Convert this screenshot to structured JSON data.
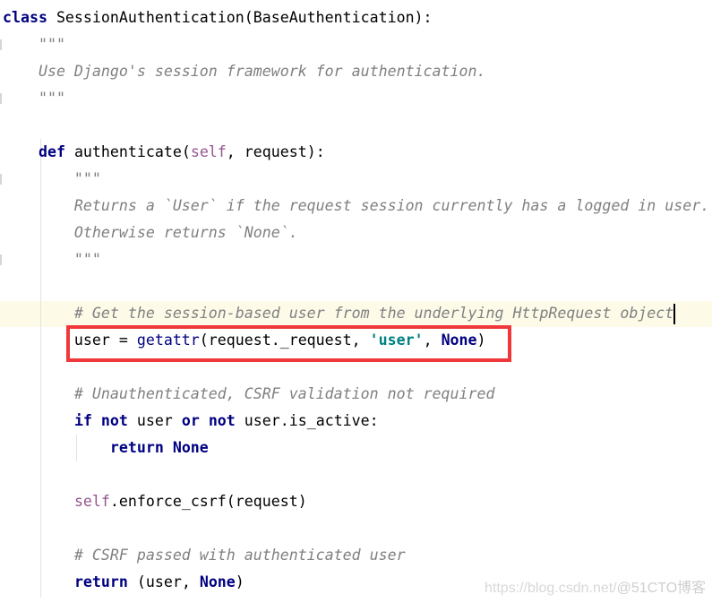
{
  "editor": {
    "lines": [
      [
        [
          "kw",
          "class"
        ],
        [
          "t",
          " SessionAuthentication(BaseAuthentication):"
        ]
      ],
      [
        [
          "doc",
          "    \"\"\""
        ]
      ],
      [
        [
          "doc",
          "    Use Django's session framework for authentication."
        ]
      ],
      [
        [
          "doc",
          "    \"\"\""
        ]
      ],
      [],
      [
        [
          "t",
          "    "
        ],
        [
          "kw",
          "def"
        ],
        [
          "t",
          " authenticate("
        ],
        [
          "self",
          "self"
        ],
        [
          "t",
          ", request):"
        ]
      ],
      [
        [
          "doc",
          "        \"\"\""
        ]
      ],
      [
        [
          "doc",
          "        Returns a `User` if the request session currently has a logged in user."
        ]
      ],
      [
        [
          "doc",
          "        Otherwise returns `None`."
        ]
      ],
      [
        [
          "doc",
          "        \"\"\""
        ]
      ],
      [],
      [
        [
          "cm",
          "        # Get the session-based user from the underlying HttpRequest object"
        ]
      ],
      [
        [
          "t",
          "        user = "
        ],
        [
          "bi",
          "getattr"
        ],
        [
          "t",
          "(request._request, "
        ],
        [
          "str",
          "'user'"
        ],
        [
          "t",
          ", "
        ],
        [
          "kw",
          "None"
        ],
        [
          "t",
          ")"
        ]
      ],
      [],
      [
        [
          "cm",
          "        # Unauthenticated, CSRF validation not required"
        ]
      ],
      [
        [
          "t",
          "        "
        ],
        [
          "kw",
          "if not"
        ],
        [
          "t",
          " user "
        ],
        [
          "kw",
          "or not"
        ],
        [
          "t",
          " user.is_active:"
        ]
      ],
      [
        [
          "t",
          "            "
        ],
        [
          "kw",
          "return None"
        ]
      ],
      [],
      [
        [
          "t",
          "        "
        ],
        [
          "self",
          "self"
        ],
        [
          "t",
          ".enforce_csrf(request)"
        ]
      ],
      [],
      [
        [
          "cm",
          "        # CSRF passed with authenticated user"
        ]
      ],
      [
        [
          "t",
          "        "
        ],
        [
          "kw",
          "return"
        ],
        [
          "t",
          " (user, "
        ],
        [
          "kw",
          "None"
        ],
        [
          "t",
          ")"
        ]
      ]
    ],
    "current_line": 11,
    "highlighted_line": 12,
    "highlight_color": "#f0383b"
  },
  "watermark": {
    "url": "https://blog.csdn.net/",
    "brand": "@51CTO博客"
  }
}
